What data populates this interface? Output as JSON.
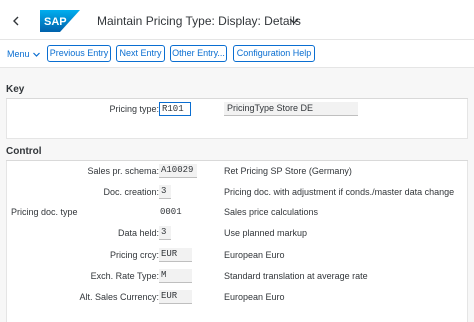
{
  "shell": {
    "back_icon": "chevron-left-icon",
    "logo_text": "SAP",
    "title": "Maintain Pricing Type: Display: Details",
    "title_icon": "chevron-down-icon"
  },
  "toolbar": {
    "menu_label": "Menu",
    "buttons": [
      "Previous Entry",
      "Next Entry",
      "Other Entry...",
      "Configuration Help"
    ]
  },
  "sections": {
    "key": {
      "title": "Key",
      "pricing_type_label": "Pricing type:",
      "pricing_type_value": "R101",
      "pricing_type_desc": "PricingType Store DE"
    },
    "control": {
      "title": "Control",
      "rows": [
        {
          "label": "Sales pr. schema:",
          "value": "A10029",
          "desc": "Ret Pricing SP Store (Germany)"
        },
        {
          "label": "Doc. creation:",
          "value": "3",
          "desc": "Pricing doc. with adjustment if conds./master data change"
        },
        {
          "label": "Pricing doc. type",
          "value": "0001",
          "desc": "Sales price calculations"
        },
        {
          "label": "Data held:",
          "value": "3",
          "desc": "Use planned markup"
        },
        {
          "label": "Pricing crcy:",
          "value": "EUR",
          "desc": "European Euro"
        },
        {
          "label": "Exch. Rate Type:",
          "value": "M",
          "desc": "Standard translation at average rate"
        },
        {
          "label": "Alt. Sales Currency:",
          "value": "EUR",
          "desc": "European Euro"
        }
      ]
    }
  },
  "colors": {
    "accent": "#0a6ed1",
    "logo_blue": "#0a6ed1"
  }
}
